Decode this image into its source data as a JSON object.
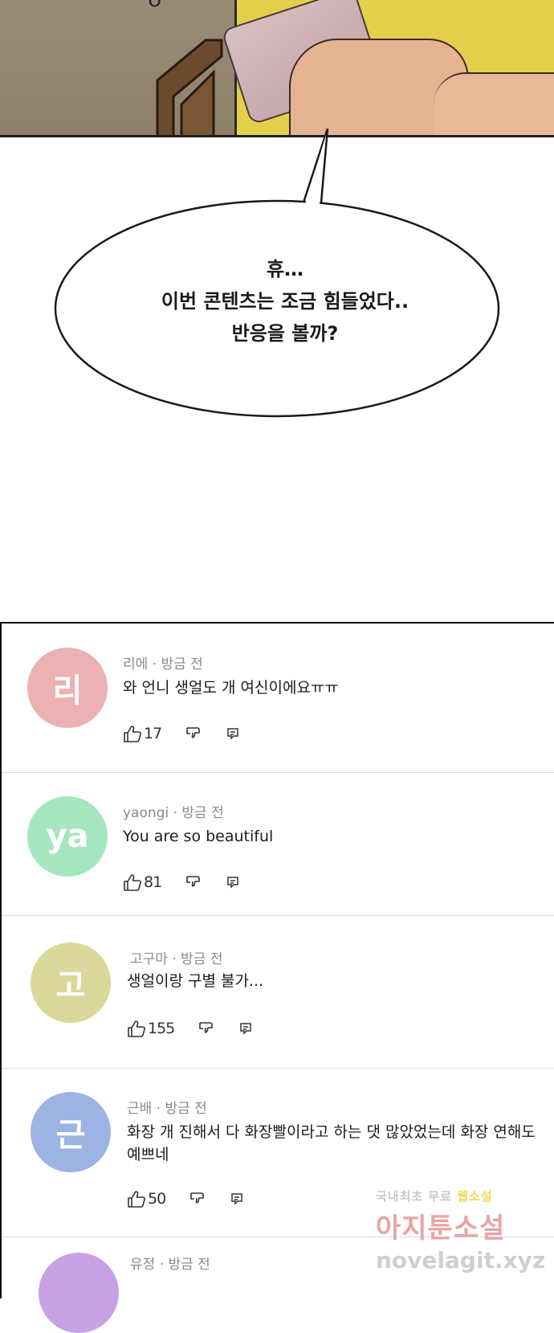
{
  "comic": {
    "speech_lines": [
      "휴…",
      "이번 콘텐츠는 조금 힘들었다..",
      "반응을 볼까?"
    ]
  },
  "comments": [
    {
      "initial": "리",
      "author": "리에",
      "time": "· 방금 전",
      "text": "와 언니 생얼도 개 여신이에요ㅠㅠ",
      "likes": "17",
      "avatar_color": "#ecb1b3"
    },
    {
      "initial": "ya",
      "author": "yaongi",
      "time": "· 방금 전",
      "text": "You are so beautiful",
      "likes": "81",
      "avatar_color": "#a6e6bf"
    },
    {
      "initial": "고",
      "author": "고구마",
      "time": "· 방금 전",
      "text": "생얼이랑 구별 불가...",
      "likes": "155",
      "avatar_color": "#d9d89a"
    },
    {
      "initial": "근",
      "author": "근배",
      "time": "· 방금 전",
      "text": "화장 개 진해서 다 화장빨이라고 하는 댓 많았었는데 화장 연해도",
      "text2": "예쁘네",
      "likes": "50",
      "avatar_color": "#9cb3e4"
    },
    {
      "initial": "",
      "author": "유정",
      "time": "· 방금 전",
      "text": "",
      "likes": "",
      "avatar_color": "#c7a0e6"
    }
  ],
  "watermark": {
    "line1": "국내최초 무료",
    "line1_highlight": "웹소설",
    "line2": "아지툰소설",
    "line3": "novelagit.xyz"
  }
}
